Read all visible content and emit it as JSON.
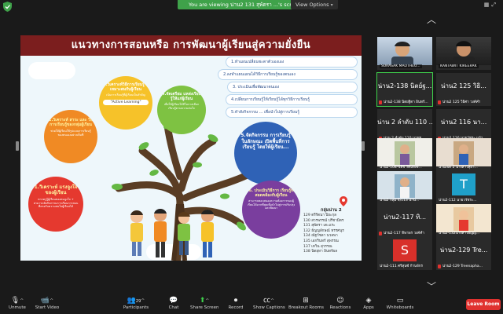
{
  "banner": {
    "viewing_text": "You are viewing น่าน2 131 สุพัตรา ...'s screen",
    "view_options": "View Options"
  },
  "slide": {
    "title": "แนวทางการสอนหรือ การพัฒนาผู้เรียนสู่ความยั่งยืน",
    "right_list": [
      "1.ทำแผนเปลี่ยนชะตาตัวเองเอง",
      "2.ลงทำแผนแผนได้วิธีการเรียนรู้ของตนเอง",
      "3. ประเมินเพื่อพัฒนาตนเอง",
      "4.เปลี่ยนการเรียนรู้ให้เรียนรู้ได้ทุกวิธีการเรียนรู้",
      "5.ทำสังกิจกรรม ... เพื่อนำไปสู่การเรียนรู้"
    ],
    "circles": [
      {
        "title": "1.วิเคราะห์ แรงจูงใจ ของผู้เรียน",
        "body": "หากครูรู้ผู้เรียนของตนจูงใจ + สามารถจัดกิจกรรมการเรียนการสอนที่ตรงกับความสนใจผู้เรียนได้",
        "color": "#e5392f"
      },
      {
        "title": "2.วิเคราะห์ สาระ และ วิธีการเรียนรู้ของกลุ่มผู้เรียน",
        "body": "ช่วยให้ผู้เรียนใช้รูปแบบการเรียนรู้ของตนเองอย่างเต็มที่",
        "color": "#f08a24"
      },
      {
        "title": "3.วิเคราะห์วิธีการเรียนรู้ ที่เหมาะสมกับผู้เรียน",
        "body": "เน้นการเรียนรู้ที่ผู้เรียนเป็นสำคัญ",
        "badge": "\"Active Learning\"",
        "color": "#f6c229"
      },
      {
        "title": "4.จัดเตรียม แหล่งเรียนรู้ให้แก่ผู้เรียน",
        "body": "เพื่อให้ผู้เรียนได้มีโอกาสเลือกเรียนรู้ตามความสนใจ",
        "color": "#7ec242"
      },
      {
        "title": "5.จัดกิจกรรม การเรียนรู้ ในลักษณะ เปิดพื้นที่การเรียนรู้ โดยให้ผู้เรียน...",
        "body": "",
        "color": "#2f62b6"
      },
      {
        "title": "6. ประเมินวิธีการ เรียนรู้ที่สอดคล้องกับผู้เรียน",
        "body": "สามารถตอบสนองความต้องการของผู้เรียนได้มากที่สุดเพื่อนำไปสู่การปรับปรุงและพัฒนา",
        "color": "#7a3e9e"
      }
    ],
    "group_title": "กลุ่มน่าน 2",
    "group_members": [
      "129 ตรีรัตนา ปิยะกุล",
      "130 สวรพรรณ์ ปรีชามิตร",
      "131 สุพัตรา เตะแระ",
      "132 ธัญญลักษณ์ ทรรศนุร",
      "134 ณัฐวัชลา นวลพา",
      "135 เอกรินทร์ สุพรรณ",
      "137 เทวิน สุวรรณ",
      "138 นิตยุทา อินทร์ผล"
    ]
  },
  "gallery": {
    "tiles": [
      {
        "label": "SURASAK MAOTHEU...",
        "type": "video",
        "active": false
      },
      {
        "label": "KANTAWIT KIREERAK",
        "type": "video",
        "active": false
      },
      {
        "label": "น่าน2-138 นิตย์ฐ...",
        "sub": "น่าน2-138 นิตยฐิดา อินทร์...",
        "type": "name",
        "active": true
      },
      {
        "label": "น่าน2 125 วิธิ...",
        "sub": "น่าน2 125 วิธิศา วงค์คำ",
        "type": "name",
        "active": false
      },
      {
        "label": "น่าน 2 ลำดับ 110 ...",
        "sub": "น่าน 2 ลำดับ 110 นายช...",
        "type": "name",
        "active": false
      },
      {
        "label": "น่าน2 116 นา...",
        "sub": "น่าน2 116 นายวัชระ แก้ว...",
        "type": "name",
        "active": false
      },
      {
        "label": "น่าน2-108-ชลิช รัตนจงจ...",
        "type": "photo",
        "active": false
      },
      {
        "label": "น่านเขต 2 นางสาวสุธา...",
        "type": "photo",
        "active": false
      },
      {
        "label": "น่าน2 กลุ่ม 4/113 น่าน...",
        "type": "photo",
        "active": false
      },
      {
        "label": "น่าน2-112 นายวรัชระ...",
        "letter": "T",
        "type": "letter",
        "active": false
      },
      {
        "label": "น่าน2-117 ทิ...",
        "sub": "น่าน2-117 ทิพาพร วงค์คำ",
        "type": "name",
        "active": false
      },
      {
        "label": "น่าน2-132นางสาวธัญญ...",
        "type": "photo",
        "active": false
      },
      {
        "label": "น่าน2-111 ศรีสุนซ์ ก้านจักร",
        "letter": "S",
        "type": "letter-red",
        "active": false
      },
      {
        "label": "น่าน2-129 Tre...",
        "sub": "น่าน2-129 Treenapha...",
        "type": "name",
        "active": false
      }
    ]
  },
  "toolbar": {
    "unmute": "Unmute",
    "start_video": "Start Video",
    "participants": "Participants",
    "participants_count": "29",
    "chat": "Chat",
    "share_screen": "Share Screen",
    "record": "Record",
    "show_captions": "Show Captions",
    "breakout": "Breakout Rooms",
    "reactions": "Reactions",
    "apps": "Apps",
    "whiteboards": "Whiteboards",
    "leave": "Leave Room"
  },
  "colors": {
    "share_green": "#3fa24a",
    "leave_red": "#e0322f",
    "title_maroon": "#7b1e1e"
  }
}
